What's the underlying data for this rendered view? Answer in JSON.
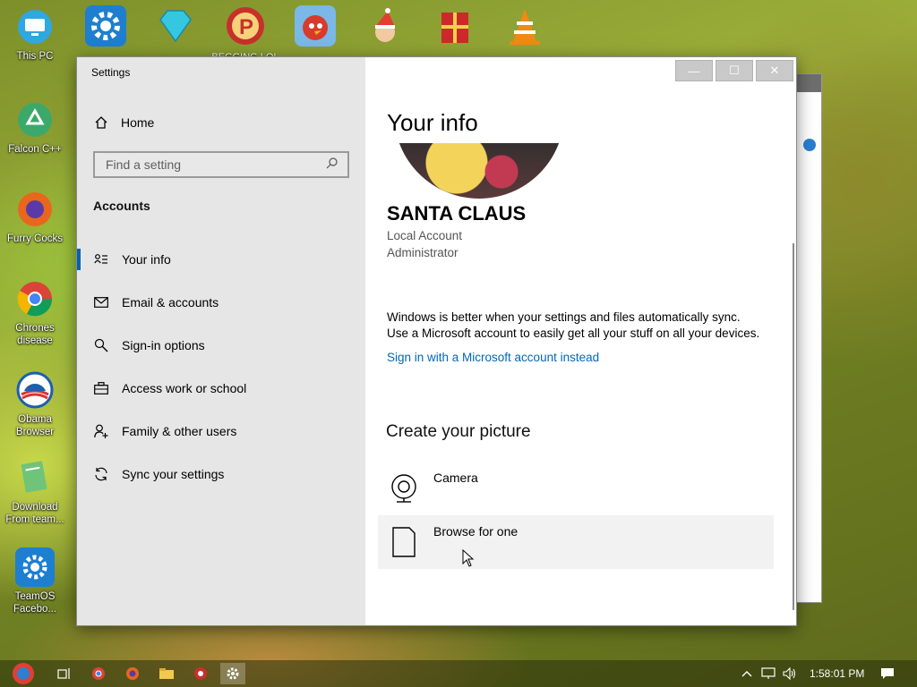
{
  "desktop": {
    "left_icons": [
      {
        "label": "This PC",
        "icon": "monitor-icon",
        "color": "#2fa7e0"
      },
      {
        "label": "Falcon C++",
        "icon": "recycle-icon",
        "color": "#3ca86a"
      },
      {
        "label": "Furry Cocks",
        "icon": "firefox-icon",
        "color": "#e8671c"
      },
      {
        "label": "Chrones disease",
        "icon": "chrome-icon",
        "color": "#db4437"
      },
      {
        "label": "Obama Browser",
        "icon": "obama-logo-icon",
        "color": "#1c5fb0"
      },
      {
        "label": "Download From team...",
        "icon": "notepad-icon",
        "color": "#6fc47a"
      },
      {
        "label": "TeamOS Facebo...",
        "icon": "gear-icon",
        "color": "#1e7fd0"
      }
    ],
    "top_icons": [
      {
        "label": "",
        "icon": "gear-icon",
        "color": "#1e7fd0"
      },
      {
        "label": "",
        "icon": "diamond-icon",
        "color": "#36c7e0"
      },
      {
        "label": "BEGGING LOL",
        "icon": "p-logo-icon",
        "color": "#c8302a"
      },
      {
        "label": "",
        "icon": "angry-bird-icon",
        "color": "#d83a2c"
      },
      {
        "label": "",
        "icon": "santa-icon",
        "color": "#e23e34"
      },
      {
        "label": "",
        "icon": "gift-box-icon",
        "color": "#cc2a2a"
      },
      {
        "label": "",
        "icon": "vlc-cone-icon",
        "color": "#f08a12"
      }
    ]
  },
  "window": {
    "title": "Settings",
    "controls": {
      "minimize": "—",
      "maximize": "☐",
      "close": "✕"
    }
  },
  "sidebar": {
    "home_label": "Home",
    "search_placeholder": "Find a setting",
    "section_title": "Accounts",
    "items": [
      {
        "label": "Your info",
        "icon": "person-card-icon",
        "active": true
      },
      {
        "label": "Email & accounts",
        "icon": "mail-icon",
        "active": false
      },
      {
        "label": "Sign-in options",
        "icon": "key-icon",
        "active": false
      },
      {
        "label": "Access work or school",
        "icon": "briefcase-icon",
        "active": false
      },
      {
        "label": "Family & other users",
        "icon": "person-add-icon",
        "active": false
      },
      {
        "label": "Sync your settings",
        "icon": "sync-icon",
        "active": false
      }
    ]
  },
  "content": {
    "title": "Your info",
    "user_name": "SANTA CLAUS",
    "account_type": "Local Account",
    "account_role": "Administrator",
    "sync_line1": "Windows is better when your settings and files automatically sync.",
    "sync_line2": "Use a Microsoft account to easily get all your stuff on all your devices.",
    "ms_link": "Sign in with a Microsoft account instead",
    "picture_header": "Create your picture",
    "options": [
      {
        "label": "Camera",
        "icon": "camera-icon"
      },
      {
        "label": "Browse for one",
        "icon": "browse-file-icon"
      }
    ]
  },
  "taskbar": {
    "clock": "1:58:01 PM",
    "accent": "#0063b1"
  }
}
